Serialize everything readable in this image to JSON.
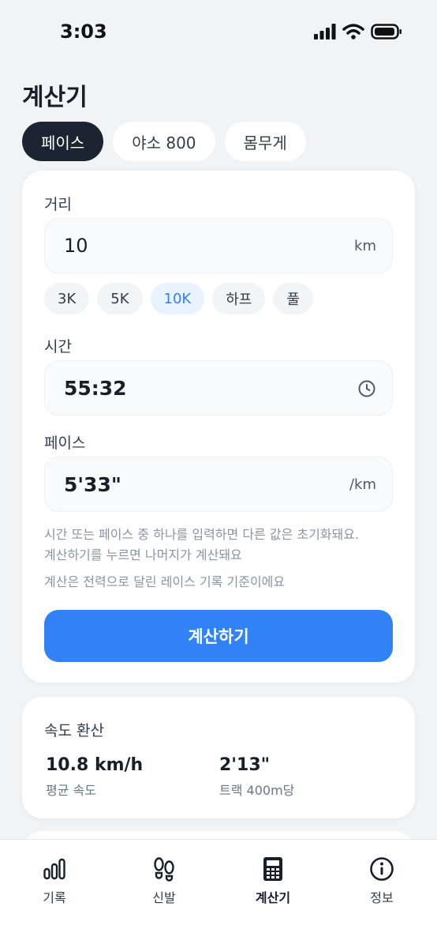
{
  "status_bar": {
    "time": "3:03"
  },
  "header": {
    "title": "계산기"
  },
  "tabs": [
    {
      "label": "페이스",
      "active": true
    },
    {
      "label": "야소 800",
      "active": false
    },
    {
      "label": "몸무게",
      "active": false
    }
  ],
  "calculator": {
    "distance": {
      "label": "거리",
      "value": "10",
      "unit": "km"
    },
    "presets": [
      {
        "label": "3K",
        "selected": false
      },
      {
        "label": "5K",
        "selected": false
      },
      {
        "label": "10K",
        "selected": true
      },
      {
        "label": "하프",
        "selected": false
      },
      {
        "label": "풀",
        "selected": false
      }
    ],
    "time": {
      "label": "시간",
      "value": "55:32",
      "icon": "clock-icon"
    },
    "pace": {
      "label": "페이스",
      "value": "5'33\"",
      "unit": "/km"
    },
    "help_lines": [
      "시간 또는 페이스 중 하나를 입력하면 다른 값은 초기화돼요.",
      "계산하기를 누르면 나머지가 계산돼요"
    ],
    "note": "계산은 전력으로 달린 레이스 기록 기준이에요",
    "button_label": "계산하기"
  },
  "speed_conversion": {
    "title": "속도 환산",
    "avg_speed": {
      "value": "10.8 km/h",
      "label": "평균 속도"
    },
    "track_pace": {
      "value": "2'13\"",
      "label": "트랙 400m당"
    }
  },
  "bottom_nav": [
    {
      "label": "기록",
      "icon": "bar-chart-icon",
      "active": false
    },
    {
      "label": "신발",
      "icon": "footprints-icon",
      "active": false
    },
    {
      "label": "계산기",
      "icon": "calculator-icon",
      "active": true
    },
    {
      "label": "정보",
      "icon": "info-icon",
      "active": false
    }
  ],
  "colors": {
    "accent": "#3182f6",
    "active_tab": "#1b2430",
    "background": "#f2f3f5"
  }
}
